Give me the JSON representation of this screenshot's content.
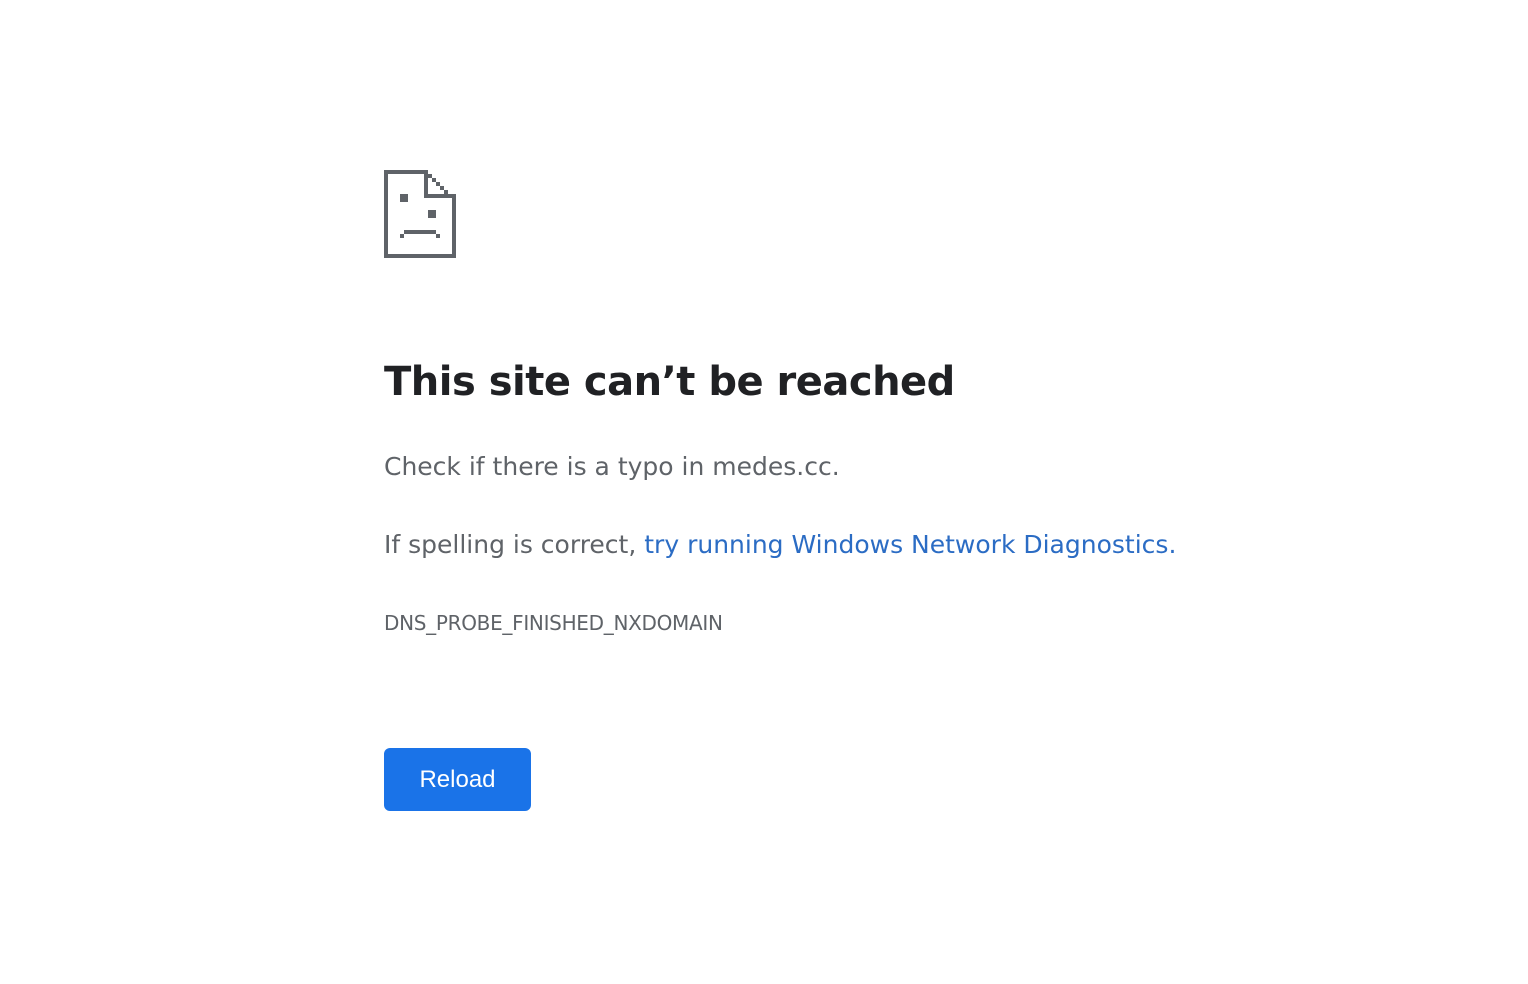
{
  "error_page": {
    "icon": "sad-page-icon",
    "title": "This site can’t be reached",
    "typo_message": "Check if there is a typo in medes.cc.",
    "spelling_prefix": "If spelling is correct, ",
    "diagnostics_link": "try running Windows Network Diagnostics",
    "diagnostics_suffix": ".",
    "error_code": "DNS_PROBE_FINISHED_NXDOMAIN",
    "reload_label": "Reload"
  },
  "colors": {
    "title": "#202124",
    "body_text": "#5f6368",
    "link": "#2b6cc4",
    "button_bg": "#1a73e8",
    "button_text": "#ffffff",
    "icon": "#5f6368"
  }
}
